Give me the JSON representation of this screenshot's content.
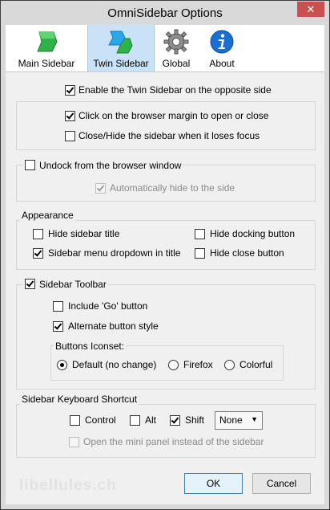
{
  "window": {
    "title": "OmniSidebar Options",
    "close_glyph": "✕"
  },
  "tabs": [
    {
      "label": "Main Sidebar",
      "icon": "main-sidebar-icon",
      "active": false
    },
    {
      "label": "Twin Sidebar",
      "icon": "twin-sidebar-icon",
      "active": true
    },
    {
      "label": "Global",
      "icon": "gear-icon",
      "active": false
    },
    {
      "label": "About",
      "icon": "info-icon",
      "active": false
    }
  ],
  "options": {
    "enable_twin": {
      "label": "Enable the Twin Sidebar on the opposite side",
      "checked": true
    },
    "click_margin": {
      "label": "Click on the browser margin to open or close",
      "checked": true
    },
    "close_hide_focus": {
      "label": "Close/Hide the sidebar when it loses focus",
      "checked": false
    },
    "undock": {
      "label": "Undock from the browser window",
      "checked": false
    },
    "auto_hide": {
      "label": "Automatically hide to the side",
      "checked": true,
      "disabled": true
    }
  },
  "appearance": {
    "title": "Appearance",
    "hide_title": {
      "label": "Hide sidebar title",
      "checked": false
    },
    "hide_docking": {
      "label": "Hide docking button",
      "checked": false
    },
    "menu_dropdown": {
      "label": "Sidebar menu dropdown in title",
      "checked": true
    },
    "hide_close": {
      "label": "Hide close button",
      "checked": false
    }
  },
  "toolbar_group": {
    "title": "Sidebar Toolbar",
    "checked": true,
    "include_go": {
      "label": "Include 'Go' button",
      "checked": false
    },
    "alternate_style": {
      "label": "Alternate button style",
      "checked": true
    },
    "iconset": {
      "title": "Buttons Iconset:",
      "options": [
        "Default (no change)",
        "Firefox",
        "Colorful"
      ],
      "selected": "Default (no change)"
    }
  },
  "shortcut": {
    "title": "Sidebar Keyboard Shortcut",
    "control": {
      "label": "Control",
      "checked": false
    },
    "alt": {
      "label": "Alt",
      "checked": false
    },
    "shift": {
      "label": "Shift",
      "checked": true
    },
    "key_select": {
      "value": "None"
    },
    "mini_panel": {
      "label": "Open the mini panel instead of the sidebar",
      "checked": false,
      "disabled": true
    }
  },
  "buttons": {
    "ok": "OK",
    "cancel": "Cancel"
  },
  "watermark": "libellules.ch",
  "colors": {
    "active_tab": "#c9e2f7",
    "close_button": "#c75050",
    "default_button_border": "#3c7fb1"
  }
}
